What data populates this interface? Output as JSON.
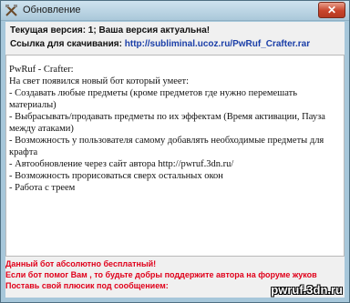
{
  "window": {
    "title": "Обновление",
    "close_label": "✕"
  },
  "info": {
    "version_text": "Текущая версия: 1; Ваша версия актуальна!",
    "link_label": "Ссылка для скачивания:",
    "link_url": "http://subliminal.ucoz.ru/PwRuf_Crafter.rar"
  },
  "description": {
    "lines": [
      "PwRuf - Crafter:",
      "На свет появился новый бот который умеет:",
      "- Создавать любые предметы (кроме предметов где нужно перемешать материалы)",
      "- Выбрасывать/продавать предметы по их эффектам (Время активации, Пауза между атаками)",
      "- Возможность у пользователя самому добавлять необходимые предметы для крафта",
      "- Автообновление через сайт автора http://pwruf.3dn.ru/",
      "- Возможность прорисоваться сверх остальных окон",
      "- Работа с треем"
    ]
  },
  "footer": {
    "line1": "Данный бот абсолютно бесплатный!",
    "line2": "Если бот помог Вам , то будьте добры поддержите автора на форуме жуков",
    "line3": "Поставь свой плюсик под сообщением:"
  },
  "watermark": "pwruf.3dn.ru",
  "colors": {
    "accent_red": "#e0001a",
    "link_blue": "#1a3ea8"
  }
}
